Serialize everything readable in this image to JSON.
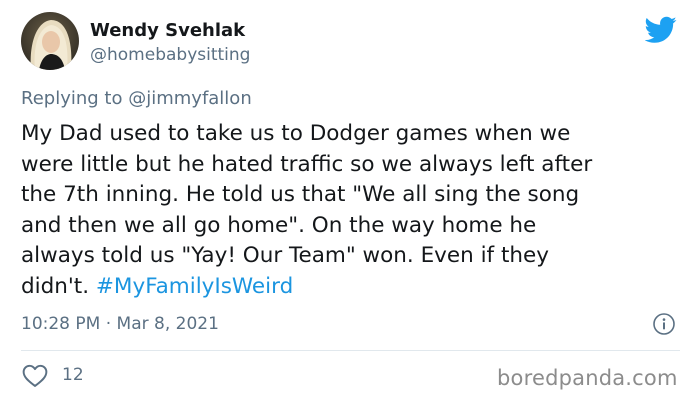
{
  "tweet": {
    "author": {
      "name": "Wendy Svehlak",
      "handle": "@homebabysitting"
    },
    "replying_to": {
      "prefix": "Replying to",
      "mention": "@jimmyfallon"
    },
    "body_lines": [
      "My Dad used to take us to Dodger games when we",
      "were little but he hated traffic so we always left after",
      "the 7th inning. He told us that \"We all sing the song",
      "and then we all go home\".  On the way home he",
      "always told us \"Yay! Our Team\" won. Even if they"
    ],
    "last_line_text": "didn't.",
    "hashtag": "#MyFamilyIsWeird",
    "timestamp": "10:28 PM · Mar 8, 2021",
    "like_count": "12"
  },
  "watermark": "boredpanda.com",
  "icons": {
    "brand": "twitter-bird-icon",
    "info": "info-icon",
    "like": "heart-icon"
  },
  "colors": {
    "twitter_blue": "#1da1f2",
    "hashtag": "#1b95e0",
    "secondary_text": "#5b7083",
    "primary_text": "#14171a",
    "divider": "#e1e8ed",
    "watermark": "#8c8c8c"
  }
}
